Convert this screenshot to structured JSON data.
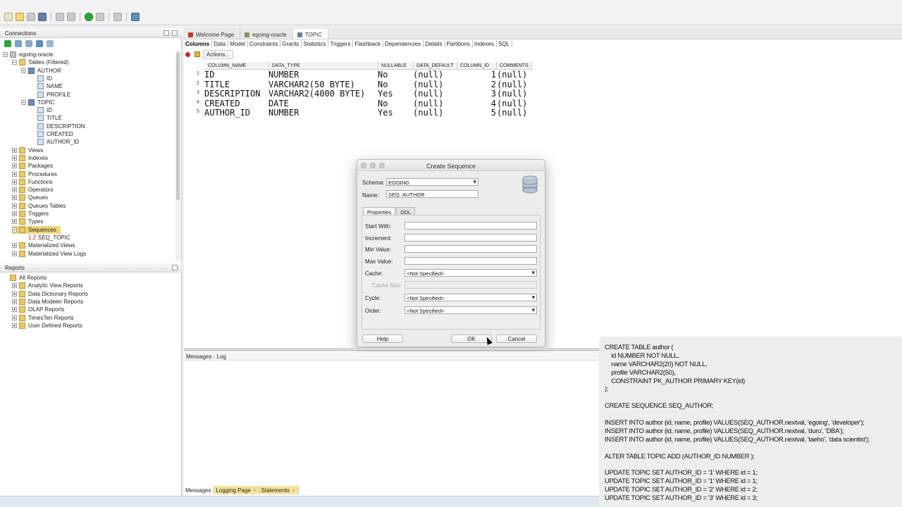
{
  "connections_panel": {
    "title": "Connections",
    "tree": [
      {
        "label": "egoing-oracle",
        "level": 0,
        "kind": "db",
        "expander": "minus"
      },
      {
        "label": "Tables (Filtered)",
        "level": 1,
        "kind": "folder",
        "expander": "minus"
      },
      {
        "label": "AUTHOR",
        "level": 2,
        "kind": "table",
        "expander": "minus"
      },
      {
        "label": "ID",
        "level": 3,
        "kind": "column"
      },
      {
        "label": "NAME",
        "level": 3,
        "kind": "column"
      },
      {
        "label": "PROFILE",
        "level": 3,
        "kind": "column"
      },
      {
        "label": "TOPIC",
        "level": 2,
        "kind": "table",
        "expander": "minus"
      },
      {
        "label": "ID",
        "level": 3,
        "kind": "column"
      },
      {
        "label": "TITLE",
        "level": 3,
        "kind": "column"
      },
      {
        "label": "DESCRIPTION",
        "level": 3,
        "kind": "column"
      },
      {
        "label": "CREATED",
        "level": 3,
        "kind": "column"
      },
      {
        "label": "AUTHOR_ID",
        "level": 3,
        "kind": "column"
      },
      {
        "label": "Views",
        "level": 1,
        "kind": "folder",
        "expander": "plus"
      },
      {
        "label": "Indexes",
        "level": 1,
        "kind": "folder",
        "expander": "plus"
      },
      {
        "label": "Packages",
        "level": 1,
        "kind": "folder",
        "expander": "plus"
      },
      {
        "label": "Procedures",
        "level": 1,
        "kind": "folder",
        "expander": "plus"
      },
      {
        "label": "Functions",
        "level": 1,
        "kind": "folder",
        "expander": "plus"
      },
      {
        "label": "Operators",
        "level": 1,
        "kind": "folder",
        "expander": "plus"
      },
      {
        "label": "Queues",
        "level": 1,
        "kind": "folder",
        "expander": "plus"
      },
      {
        "label": "Queues Tables",
        "level": 1,
        "kind": "folder",
        "expander": "plus"
      },
      {
        "label": "Triggers",
        "level": 1,
        "kind": "folder",
        "expander": "plus"
      },
      {
        "label": "Types",
        "level": 1,
        "kind": "folder",
        "expander": "plus"
      },
      {
        "label": "Sequences",
        "level": 1,
        "kind": "folder",
        "expander": "minus",
        "selected": true
      },
      {
        "label": "SEQ_TOPIC",
        "level": 2,
        "kind": "sequence"
      },
      {
        "label": "Materialized Views",
        "level": 1,
        "kind": "folder",
        "expander": "plus"
      },
      {
        "label": "Materialized View Logs",
        "level": 1,
        "kind": "folder",
        "expander": "plus"
      }
    ]
  },
  "reports_panel": {
    "title": "Reports",
    "tree": [
      {
        "label": "All Reports",
        "level": 0,
        "kind": "folder"
      },
      {
        "label": "Analytic View Reports",
        "level": 1,
        "kind": "folder",
        "expander": "plus"
      },
      {
        "label": "Data Dictionary Reports",
        "level": 1,
        "kind": "folder",
        "expander": "plus"
      },
      {
        "label": "Data Modeler Reports",
        "level": 1,
        "kind": "folder",
        "expander": "plus"
      },
      {
        "label": "OLAP Reports",
        "level": 1,
        "kind": "folder",
        "expander": "plus"
      },
      {
        "label": "TimesTen Reports",
        "level": 1,
        "kind": "folder",
        "expander": "plus"
      },
      {
        "label": "User Defined Reports",
        "level": 1,
        "kind": "folder",
        "expander": "plus"
      }
    ]
  },
  "doc_tabs": [
    {
      "label": "Welcome Page",
      "color": "#c0392b"
    },
    {
      "label": "egoing-oracle",
      "color": "#8a8f63"
    },
    {
      "label": "TOPIC",
      "color": "#5b7fa6",
      "active": true
    }
  ],
  "sub_tabs": [
    "Columns",
    "Data",
    "Model",
    "Constraints",
    "Grants",
    "Statistics",
    "Triggers",
    "Flashback",
    "Dependencies",
    "Details",
    "Partitions",
    "Indexes",
    "SQL"
  ],
  "actions_label": "Actions...",
  "columns_grid": {
    "headers": [
      "COLUMN_NAME",
      "DATA_TYPE",
      "NULLABLE",
      "DATA_DEFAULT",
      "COLUMN_ID",
      "COMMENTS"
    ],
    "rows": [
      {
        "n": "1",
        "name": "ID",
        "type": "NUMBER",
        "nullable": "No",
        "default": "(null)",
        "id": "1",
        "comments": "(null)"
      },
      {
        "n": "2",
        "name": "TITLE",
        "type": "VARCHAR2(50 BYTE)",
        "nullable": "No",
        "default": "(null)",
        "id": "2",
        "comments": "(null)"
      },
      {
        "n": "3",
        "name": "DESCRIPTION",
        "type": "VARCHAR2(4000 BYTE)",
        "nullable": "Yes",
        "default": "(null)",
        "id": "3",
        "comments": "(null)"
      },
      {
        "n": "4",
        "name": "CREATED",
        "type": "DATE",
        "nullable": "No",
        "default": "(null)",
        "id": "4",
        "comments": "(null)"
      },
      {
        "n": "5",
        "name": "AUTHOR_ID",
        "type": "NUMBER",
        "nullable": "Yes",
        "default": "(null)",
        "id": "5",
        "comments": "(null)"
      }
    ]
  },
  "dialog": {
    "title": "Create Sequence",
    "schema_label": "Schema:",
    "schema_value": "EGOING",
    "name_label": "Name:",
    "name_value": "SEQ_AUTHOR",
    "tabs": [
      "Properties",
      "DDL"
    ],
    "start_with_label": "Start With:",
    "increment_label": "Increment:",
    "min_value_label": "Min Value:",
    "max_value_label": "Max Value:",
    "cache_label": "Cache:",
    "cache_value": "<Not Specified>",
    "cache_size_label": "Cache Size",
    "cycle_label": "Cycle:",
    "cycle_value": "<Not Specified>",
    "order_label": "Order:",
    "order_value": "<Not Specified>",
    "help_label": "Help",
    "ok_label": "OK",
    "cancel_label": "Cancel"
  },
  "messages_title": "Messages - Log",
  "bottom_tabs": [
    "Messages",
    "Logging Page",
    "Statements"
  ],
  "sql_overlay": [
    "CREATE TABLE author (",
    "    id NUMBER NOT NULL,",
    "    name VARCHAR2(20) NOT NULL,",
    "    profile VARCHAR2(50),",
    "    CONSTRAINT PK_AUTHOR PRIMARY KEY(id)",
    ");",
    "",
    "CREATE SEQUENCE SEQ_AUTHOR;",
    "",
    "INSERT INTO author (id, name, profile) VALUES(SEQ_AUTHOR.nextval, 'egoing', 'developer');",
    "INSERT INTO author (id, name, profile) VALUES(SEQ_AUTHOR.nextval, 'duru', 'DBA');",
    "INSERT INTO author (id, name, profile) VALUES(SEQ_AUTHOR.nextval, 'taeho', 'data scientist');",
    "",
    "ALTER TABLE TOPIC ADD (AUTHOR_ID NUMBER );",
    "",
    "UPDATE TOPIC SET AUTHOR_ID = '1' WHERE id = 1;",
    "UPDATE TOPIC SET AUTHOR_ID = '1' WHERE id = 1;",
    "UPDATE TOPIC SET AUTHOR_ID = '2' WHERE id = 2;",
    "UPDATE TOPIC SET AUTHOR_ID = '3' WHERE id = 3;"
  ]
}
